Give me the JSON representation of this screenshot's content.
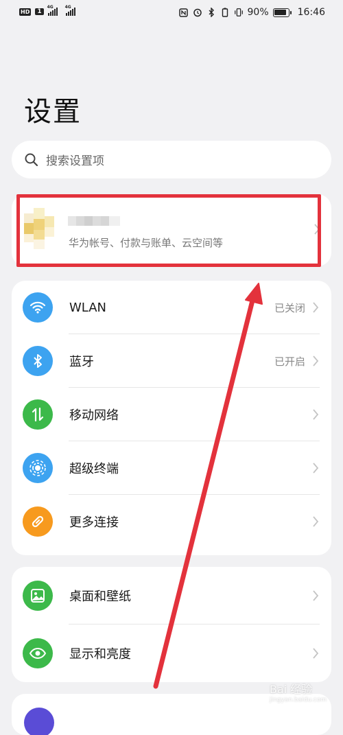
{
  "status_bar": {
    "hd_badge": "HD",
    "sim_badge": "1",
    "network_1": "4G",
    "network_2": "4G",
    "battery_percent": "90%",
    "battery_level": 0.9,
    "time": "16:46"
  },
  "page_title": "设置",
  "search": {
    "placeholder": "搜索设置项"
  },
  "account": {
    "subtitle": "华为帐号、付款与账单、云空间等"
  },
  "connectivity": [
    {
      "label": "WLAN",
      "value": "已关闭",
      "icon": "wifi-icon",
      "color": "#3da3f0"
    },
    {
      "label": "蓝牙",
      "value": "已开启",
      "icon": "bluetooth-icon",
      "color": "#3da3f0"
    },
    {
      "label": "移动网络",
      "value": "",
      "icon": "mobile-data-icon",
      "color": "#3cb94a"
    },
    {
      "label": "超级终端",
      "value": "",
      "icon": "super-device-icon",
      "color": "#3da3f0"
    },
    {
      "label": "更多连接",
      "value": "",
      "icon": "link-icon",
      "color": "#f79a1e"
    }
  ],
  "display": [
    {
      "label": "桌面和壁纸",
      "icon": "wallpaper-icon",
      "color": "#3cb94a"
    },
    {
      "label": "显示和亮度",
      "icon": "eye-icon",
      "color": "#3cb94a"
    }
  ],
  "annotation": {
    "highlight_color": "#e3323c"
  },
  "watermark": {
    "text": "Bai 经验",
    "sub": "jingyan.baidu.com"
  }
}
